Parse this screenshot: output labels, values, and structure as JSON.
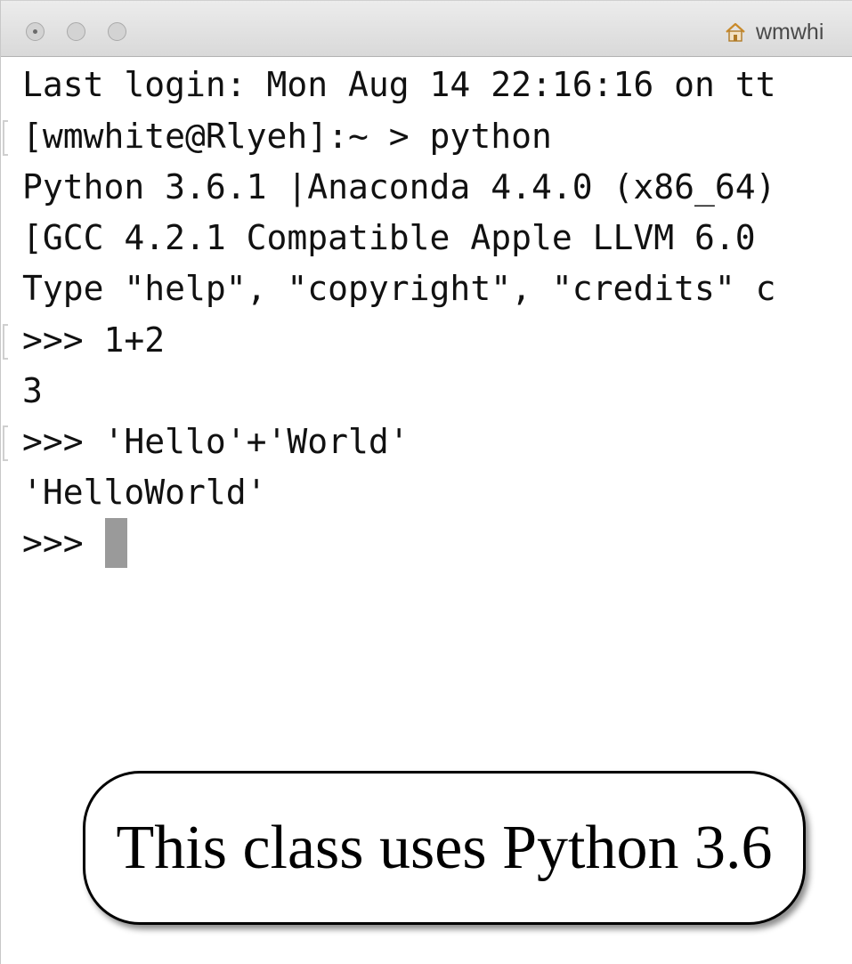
{
  "window": {
    "title": "wmwhi",
    "title_icon": "home-icon"
  },
  "terminal": {
    "lines": [
      "Last login: Mon Aug 14 22:16:16 on tt",
      "[wmwhite@Rlyeh]:~ > python",
      "Python 3.6.1 |Anaconda 4.4.0 (x86_64)",
      "[GCC 4.2.1 Compatible Apple LLVM 6.0",
      "Type \"help\", \"copyright\", \"credits\" c",
      ">>> 1+2",
      "3",
      ">>> 'Hello'+'World'",
      "'HelloWorld'"
    ],
    "prompt": ">>>"
  },
  "callout": {
    "text": "This class uses Python 3.6"
  }
}
